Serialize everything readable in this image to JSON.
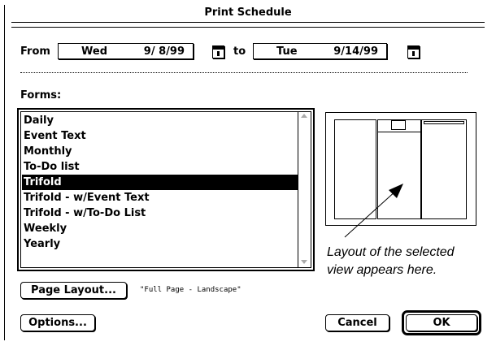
{
  "window": {
    "title": "Print Schedule"
  },
  "range": {
    "from_label": "From",
    "from_day": "Wed",
    "from_date": "9/ 8/99",
    "to_label": "to",
    "to_day": "Tue",
    "to_date": "9/14/99"
  },
  "forms": {
    "label": "Forms:",
    "items": [
      "Daily",
      "Event Text",
      "Monthly",
      "To-Do list",
      "Trifold",
      "Trifold - w/Event Text",
      "Trifold - w/To-Do List",
      "Weekly",
      "Yearly"
    ],
    "selected": "Trifold"
  },
  "preview": {
    "caption_line1": "Layout of the selected",
    "caption_line2": "view appears here."
  },
  "page_layout": {
    "button_label": "Page Layout...",
    "value": "\"Full Page - Landscape\""
  },
  "buttons": {
    "options": "Options...",
    "cancel": "Cancel",
    "ok": "OK"
  },
  "icons": {
    "from_calendar": "calendar-icon",
    "to_calendar": "calendar-icon",
    "scroll_up": "up-arrow-icon",
    "scroll_down": "down-arrow-icon"
  }
}
